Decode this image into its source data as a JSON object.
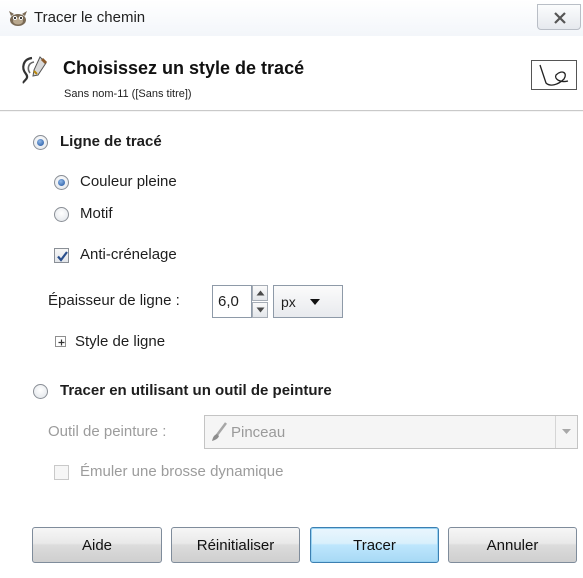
{
  "window": {
    "title": "Tracer le chemin",
    "app_icon": "gimp-wilber-icon",
    "close_icon": "close-x-icon"
  },
  "header": {
    "title": "Choisissez un style de tracé",
    "subtitle": "Sans nom-11 ([Sans titre])",
    "icon": "stroke-path-icon",
    "preview_icon": "path-preview-icon"
  },
  "stroke_line": {
    "label": "Ligne de tracé",
    "selected": true,
    "fill_options": [
      {
        "label": "Couleur pleine",
        "selected": true
      },
      {
        "label": "Motif",
        "selected": false
      }
    ],
    "antialias": {
      "label": "Anti-crénelage",
      "checked": true
    },
    "line_width": {
      "label": "Épaisseur de ligne :",
      "value": "6,0",
      "unit": "px"
    },
    "line_style": {
      "label": "Style de ligne",
      "expanded": false
    }
  },
  "paint_tool": {
    "label": "Tracer en utilisant un outil de peinture",
    "selected": false,
    "tool_label": "Outil de peinture :",
    "tool_value": "Pinceau",
    "tool_icon": "paintbrush-icon",
    "emulate": {
      "label": "Émuler une brosse dynamique",
      "checked": false
    }
  },
  "buttons": {
    "help": "Aide",
    "reset": "Réinitialiser",
    "stroke": "Tracer",
    "cancel": "Annuler"
  },
  "colors": {
    "radio_accent": "#1b4f9c",
    "default_button": "#3c7fb1",
    "disabled_text": "#9c9c9c"
  }
}
